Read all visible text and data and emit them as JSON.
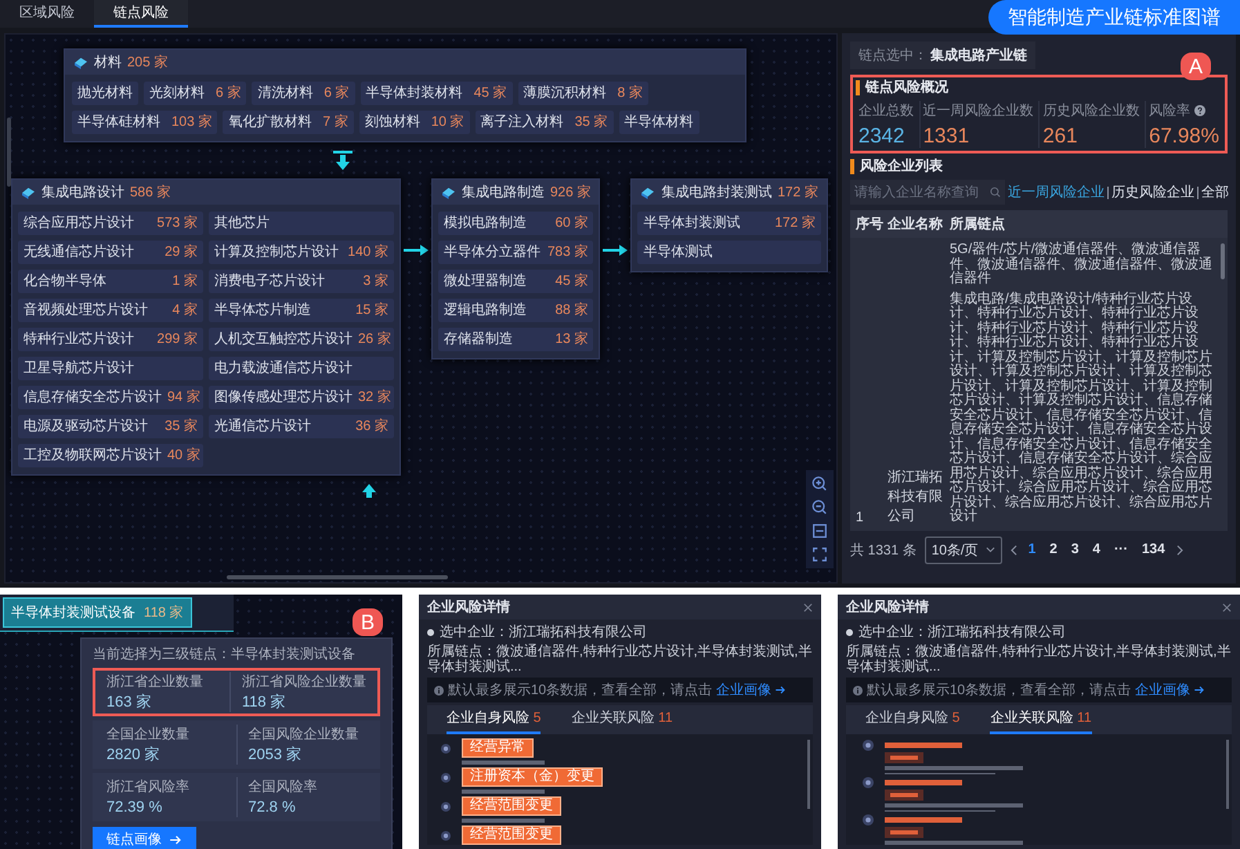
{
  "top_tabs": [
    {
      "label": "区域风险",
      "selected": false
    },
    {
      "label": "链点风险",
      "selected": true
    }
  ],
  "banner": "智能制造产业链标准图谱",
  "materials": {
    "name": "材料",
    "count": "205 家",
    "items": [
      {
        "name": "抛光材料"
      },
      {
        "name": "光刻材料",
        "count": "6 家"
      },
      {
        "name": "清洗材料",
        "count": "6 家"
      },
      {
        "name": "半导体封装材料",
        "count": "45 家"
      },
      {
        "name": "薄膜沉积材料",
        "count": "8 家"
      },
      {
        "name": "半导体硅材料",
        "count": "103 家"
      },
      {
        "name": "氧化扩散材料",
        "count": "7 家"
      },
      {
        "name": "刻蚀材料",
        "count": "10 家"
      },
      {
        "name": "离子注入材料",
        "count": "35 家"
      },
      {
        "name": "半导体材料"
      }
    ]
  },
  "stages": [
    {
      "name": "集成电路设计",
      "count": "586 家",
      "items": [
        {
          "name": "综合应用芯片设计",
          "count": "573 家"
        },
        {
          "name": "其他芯片"
        },
        {
          "name": "无线通信芯片设计",
          "count": "29 家"
        },
        {
          "name": "计算及控制芯片设计",
          "count": "140 家"
        },
        {
          "name": "化合物半导体",
          "count": "1 家"
        },
        {
          "name": "消费电子芯片设计",
          "count": "3 家"
        },
        {
          "name": "音视频处理芯片设计",
          "count": "4 家"
        },
        {
          "name": "半导体芯片制造",
          "count": "15 家"
        },
        {
          "name": "特种行业芯片设计",
          "count": "299 家"
        },
        {
          "name": "人机交互触控芯片设计",
          "count": "26 家"
        },
        {
          "name": "卫星导航芯片设计"
        },
        {
          "name": "电力载波通信芯片设计"
        },
        {
          "name": "信息存储安全芯片设计",
          "count": "94 家"
        },
        {
          "name": "图像传感处理芯片设计",
          "count": "32 家"
        },
        {
          "name": "电源及驱动芯片设计",
          "count": "35 家"
        },
        {
          "name": "光通信芯片设计",
          "count": "36 家"
        },
        {
          "name": "工控及物联网芯片设计",
          "count": "40 家"
        }
      ]
    },
    {
      "name": "集成电路制造",
      "count": "926 家",
      "items": [
        {
          "name": "模拟电路制造",
          "count": "60 家"
        },
        {
          "name": "半导体分立器件",
          "count": "783 家"
        },
        {
          "name": "微处理器制造",
          "count": "45 家"
        },
        {
          "name": "逻辑电路制造",
          "count": "88 家"
        },
        {
          "name": "存储器制造",
          "count": "13 家"
        }
      ]
    },
    {
      "name": "集成电路封装测试",
      "count": "172 家",
      "items": [
        {
          "name": "半导体封装测试",
          "count": "172 家"
        },
        {
          "name": "半导体测试"
        }
      ]
    }
  ],
  "right_panel": {
    "chain_selected": {
      "label": "链点选中：",
      "value": "集成电路产业链"
    },
    "overview": {
      "title": "链点风险概况",
      "highlighted": true,
      "callout": "A",
      "stats": [
        {
          "label": "企业总数",
          "value": "2342",
          "color": "#5ab4e5",
          "help": false
        },
        {
          "label": "近一周风险企业数",
          "value": "1331",
          "color": "#e8875c",
          "help": false
        },
        {
          "label": "历史风险企业数",
          "value": "261",
          "color": "#e8875c",
          "help": false
        },
        {
          "label": "风险率",
          "value": "67.98%",
          "color": "#e8875c",
          "help": true
        }
      ]
    },
    "risk_list": {
      "title": "风险企业列表",
      "search_placeholder": "请输入企业名称查询",
      "filters": [
        {
          "label": "近一周风险企业",
          "selected": true
        },
        {
          "label": "历史风险企业",
          "selected": false
        },
        {
          "label": "全部",
          "selected": false
        }
      ],
      "columns": [
        "序号",
        "企业名称",
        "所属链点"
      ],
      "rows": [
        {
          "index": "1",
          "name": "浙江瑞拓科技有限公司",
          "chain": [
            "5G/器件/芯片/微波通信器件、微波通信器件、微波通信器件、微波通信器件、微波通信器件",
            "集成电路/集成电路设计/特种行业芯片设计、特种行业芯片设计、特种行业芯片设计、特种行业芯片设计、特种行业芯片设计、特种行业芯片设计、特种行业芯片设计、计算及控制芯片设计、计算及控制芯片设计、计算及控制芯片设计、计算及控制芯片设计、计算及控制芯片设计、计算及控制芯片设计、计算及控制芯片设计、信息存储安全芯片设计、信息存储安全芯片设计、信息存储安全芯片设计、信息存储安全芯片设计、信息存储安全芯片设计、信息存储安全芯片设计、信息存储安全芯片设计、综合应用芯片设计、综合应用芯片设计、综合应用芯片设计、综合应用芯片设计、综合应用芯片设计、综合应用芯片设计、综合应用芯片设计"
          ]
        }
      ],
      "total": "共 1331 条",
      "page_size": "10条/页",
      "pages": [
        {
          "label": "1",
          "selected": true
        },
        {
          "label": "2",
          "selected": false
        },
        {
          "label": "3",
          "selected": false
        },
        {
          "label": "4",
          "selected": false
        },
        {
          "label": "···",
          "selected": false
        },
        {
          "label": "134",
          "selected": false
        }
      ]
    }
  },
  "node_popover": {
    "node": {
      "name": "半导体封装测试设备",
      "count": "118 家"
    },
    "subtitle": "当前选择为三级链点：半导体封装测试设备",
    "callout": "B",
    "rows": [
      {
        "highlighted": true,
        "cells": [
          {
            "label": "浙江省企业数量",
            "value": "163 家"
          },
          {
            "label": "浙江省风险企业数量",
            "value": "118 家"
          }
        ]
      },
      {
        "highlighted": false,
        "cells": [
          {
            "label": "全国企业数量",
            "value": "2820 家"
          },
          {
            "label": "全国风险企业数量",
            "value": "2053 家"
          }
        ]
      },
      {
        "highlighted": false,
        "cells": [
          {
            "label": "浙江省风险率",
            "value": "72.39 %"
          },
          {
            "label": "全国风险率",
            "value": "72.8 %"
          }
        ]
      }
    ],
    "button": "链点画像"
  },
  "detail_panels": [
    {
      "kind": "self",
      "title": "企业风险详情",
      "company": "选中企业：浙江瑞拓科技有限公司",
      "chain": "所属链点：微波通信器件,特种行业芯片设计,半导体封装测试,半导体封装测试...",
      "notice": "默认最多展示10条数据，查看全部，请点击",
      "notice_link": "企业画像",
      "tabs": [
        {
          "label": "企业自身风险",
          "count": "5",
          "selected": true
        },
        {
          "label": "企业关联风险",
          "count": "11",
          "selected": false
        }
      ],
      "risks": [
        {
          "tag": "经营异常"
        },
        {
          "tag": "注册资本（金）变更"
        },
        {
          "tag": "经营范围变更"
        },
        {
          "tag": "经营范围变更"
        }
      ]
    },
    {
      "kind": "related",
      "title": "企业风险详情",
      "company": "选中企业：浙江瑞拓科技有限公司",
      "chain": "所属链点：微波通信器件,特种行业芯片设计,半导体封装测试,半导体封装测试...",
      "notice": "默认最多展示10条数据，查看全部，请点击",
      "notice_link": "企业画像",
      "tabs": [
        {
          "label": "企业自身风险",
          "count": "5",
          "selected": false
        },
        {
          "label": "企业关联风险",
          "count": "11",
          "selected": true
        }
      ]
    }
  ]
}
